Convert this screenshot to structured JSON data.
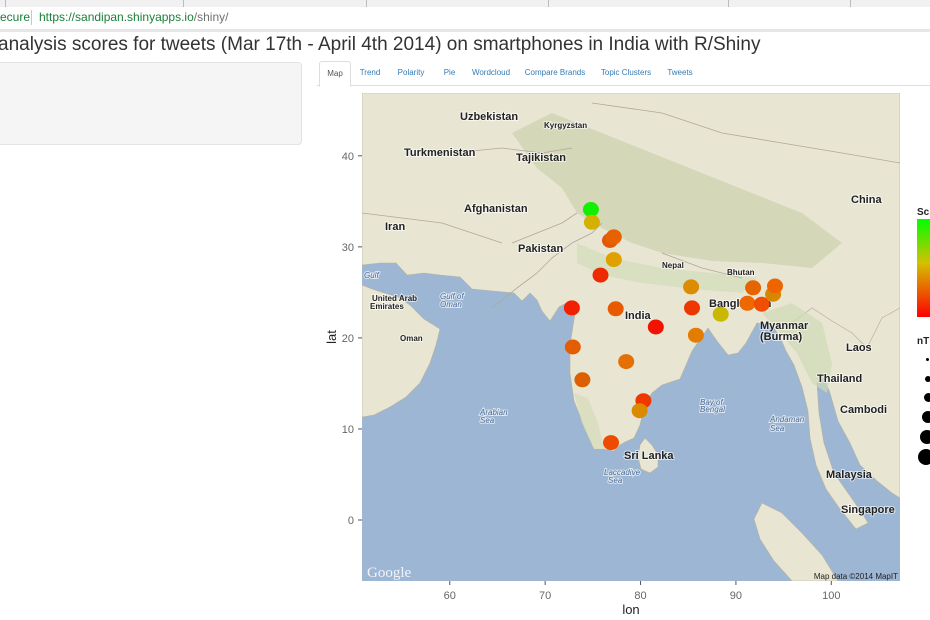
{
  "browser": {
    "secure_label": "ecure",
    "url_host": "https://sandipan.shinyapps.io",
    "url_path": "/shiny/"
  },
  "page": {
    "title": "analysis scores for tweets (Mar 17th - April 4th 2014) on smartphones in India with R/Shiny"
  },
  "tabs": [
    {
      "label": "Map",
      "active": true
    },
    {
      "label": "Trend"
    },
    {
      "label": "Polarity"
    },
    {
      "label": "Pie"
    },
    {
      "label": "Wordcloud"
    },
    {
      "label": "Compare Brands"
    },
    {
      "label": "Topic Clusters"
    },
    {
      "label": "Tweets"
    }
  ],
  "map": {
    "x_title": "lon",
    "y_title": "lat",
    "x_ticks": [
      "60",
      "70",
      "80",
      "90",
      "100"
    ],
    "y_ticks": [
      "0",
      "10",
      "20",
      "30",
      "40"
    ],
    "xlim": [
      50.8,
      107.2
    ],
    "ylim": [
      -6.7,
      46.9
    ],
    "attribution": "Map data ©2014 MapIT",
    "watermark": "Google",
    "labels": [
      {
        "text": "Uzbekistan",
        "kind": "country"
      },
      {
        "text": "Kyrgyzstan",
        "kind": "small"
      },
      {
        "text": "Turkmenistan",
        "kind": "country"
      },
      {
        "text": "Tajikistan",
        "kind": "country"
      },
      {
        "text": "China",
        "kind": "country"
      },
      {
        "text": "Afghanistan",
        "kind": "country"
      },
      {
        "text": "Iran",
        "kind": "country"
      },
      {
        "text": "Pakistan",
        "kind": "country"
      },
      {
        "text": "Nepal",
        "kind": "small"
      },
      {
        "text": "Bhutan",
        "kind": "small"
      },
      {
        "text": "Gulf",
        "kind": "water"
      },
      {
        "text": "United Arab",
        "kind": "small"
      },
      {
        "text": "Emirates",
        "kind": "small"
      },
      {
        "text": "Gulf of",
        "kind": "water"
      },
      {
        "text": "Oman",
        "kind": "water"
      },
      {
        "text": "Oman",
        "kind": "small"
      },
      {
        "text": "Bangladesh",
        "kind": "country"
      },
      {
        "text": "India",
        "kind": "country"
      },
      {
        "text": "Myanmar",
        "kind": "country"
      },
      {
        "text": "(Burma)",
        "kind": "country"
      },
      {
        "text": "Laos",
        "kind": "country"
      },
      {
        "text": "Thailand",
        "kind": "country"
      },
      {
        "text": "Cambodi",
        "kind": "country"
      },
      {
        "text": "Arabian",
        "kind": "water"
      },
      {
        "text": "Sea",
        "kind": "water"
      },
      {
        "text": "Bay of",
        "kind": "water"
      },
      {
        "text": "Bengal",
        "kind": "water"
      },
      {
        "text": "Andaman",
        "kind": "water"
      },
      {
        "text": "Sea",
        "kind": "water"
      },
      {
        "text": "Sri Lanka",
        "kind": "country"
      },
      {
        "text": "Laccadive",
        "kind": "water"
      },
      {
        "text": "Sea",
        "kind": "water"
      },
      {
        "text": "Malaysia",
        "kind": "country"
      },
      {
        "text": "Singapore",
        "kind": "country"
      }
    ],
    "legend": {
      "color_title": "Sc",
      "size_title": "nT",
      "colors": [
        "#00ff00",
        "#d4c000",
        "#ff0000"
      ]
    },
    "points": [
      {
        "lon": 74.8,
        "lat": 34.1,
        "color": "#10f000"
      },
      {
        "lon": 74.9,
        "lat": 32.7,
        "color": "#d4b000"
      },
      {
        "lon": 76.8,
        "lat": 30.7,
        "color": "#e05a00"
      },
      {
        "lon": 77.2,
        "lat": 31.1,
        "color": "#e86000"
      },
      {
        "lon": 77.2,
        "lat": 28.6,
        "color": "#dfa000"
      },
      {
        "lon": 75.8,
        "lat": 26.9,
        "color": "#ee2a00"
      },
      {
        "lon": 72.8,
        "lat": 23.3,
        "color": "#f02000"
      },
      {
        "lon": 77.4,
        "lat": 23.2,
        "color": "#e85a00"
      },
      {
        "lon": 81.6,
        "lat": 21.2,
        "color": "#f21200"
      },
      {
        "lon": 85.3,
        "lat": 25.6,
        "color": "#dc8c00"
      },
      {
        "lon": 85.4,
        "lat": 23.3,
        "color": "#ee3600"
      },
      {
        "lon": 88.4,
        "lat": 22.6,
        "color": "#c8b800"
      },
      {
        "lon": 85.8,
        "lat": 20.3,
        "color": "#e47c00"
      },
      {
        "lon": 72.9,
        "lat": 19.0,
        "color": "#e25e00"
      },
      {
        "lon": 78.5,
        "lat": 17.4,
        "color": "#e37000"
      },
      {
        "lon": 73.9,
        "lat": 15.4,
        "color": "#dc6000"
      },
      {
        "lon": 80.3,
        "lat": 13.1,
        "color": "#ee3800"
      },
      {
        "lon": 79.9,
        "lat": 12.0,
        "color": "#dc8a00"
      },
      {
        "lon": 76.9,
        "lat": 8.5,
        "color": "#ee4a00"
      },
      {
        "lon": 91.2,
        "lat": 23.8,
        "color": "#ee6800"
      },
      {
        "lon": 92.7,
        "lat": 23.7,
        "color": "#f04e00"
      },
      {
        "lon": 91.8,
        "lat": 25.5,
        "color": "#e46400"
      },
      {
        "lon": 93.9,
        "lat": 24.8,
        "color": "#d68600"
      },
      {
        "lon": 94.1,
        "lat": 25.7,
        "color": "#f06400"
      }
    ]
  }
}
